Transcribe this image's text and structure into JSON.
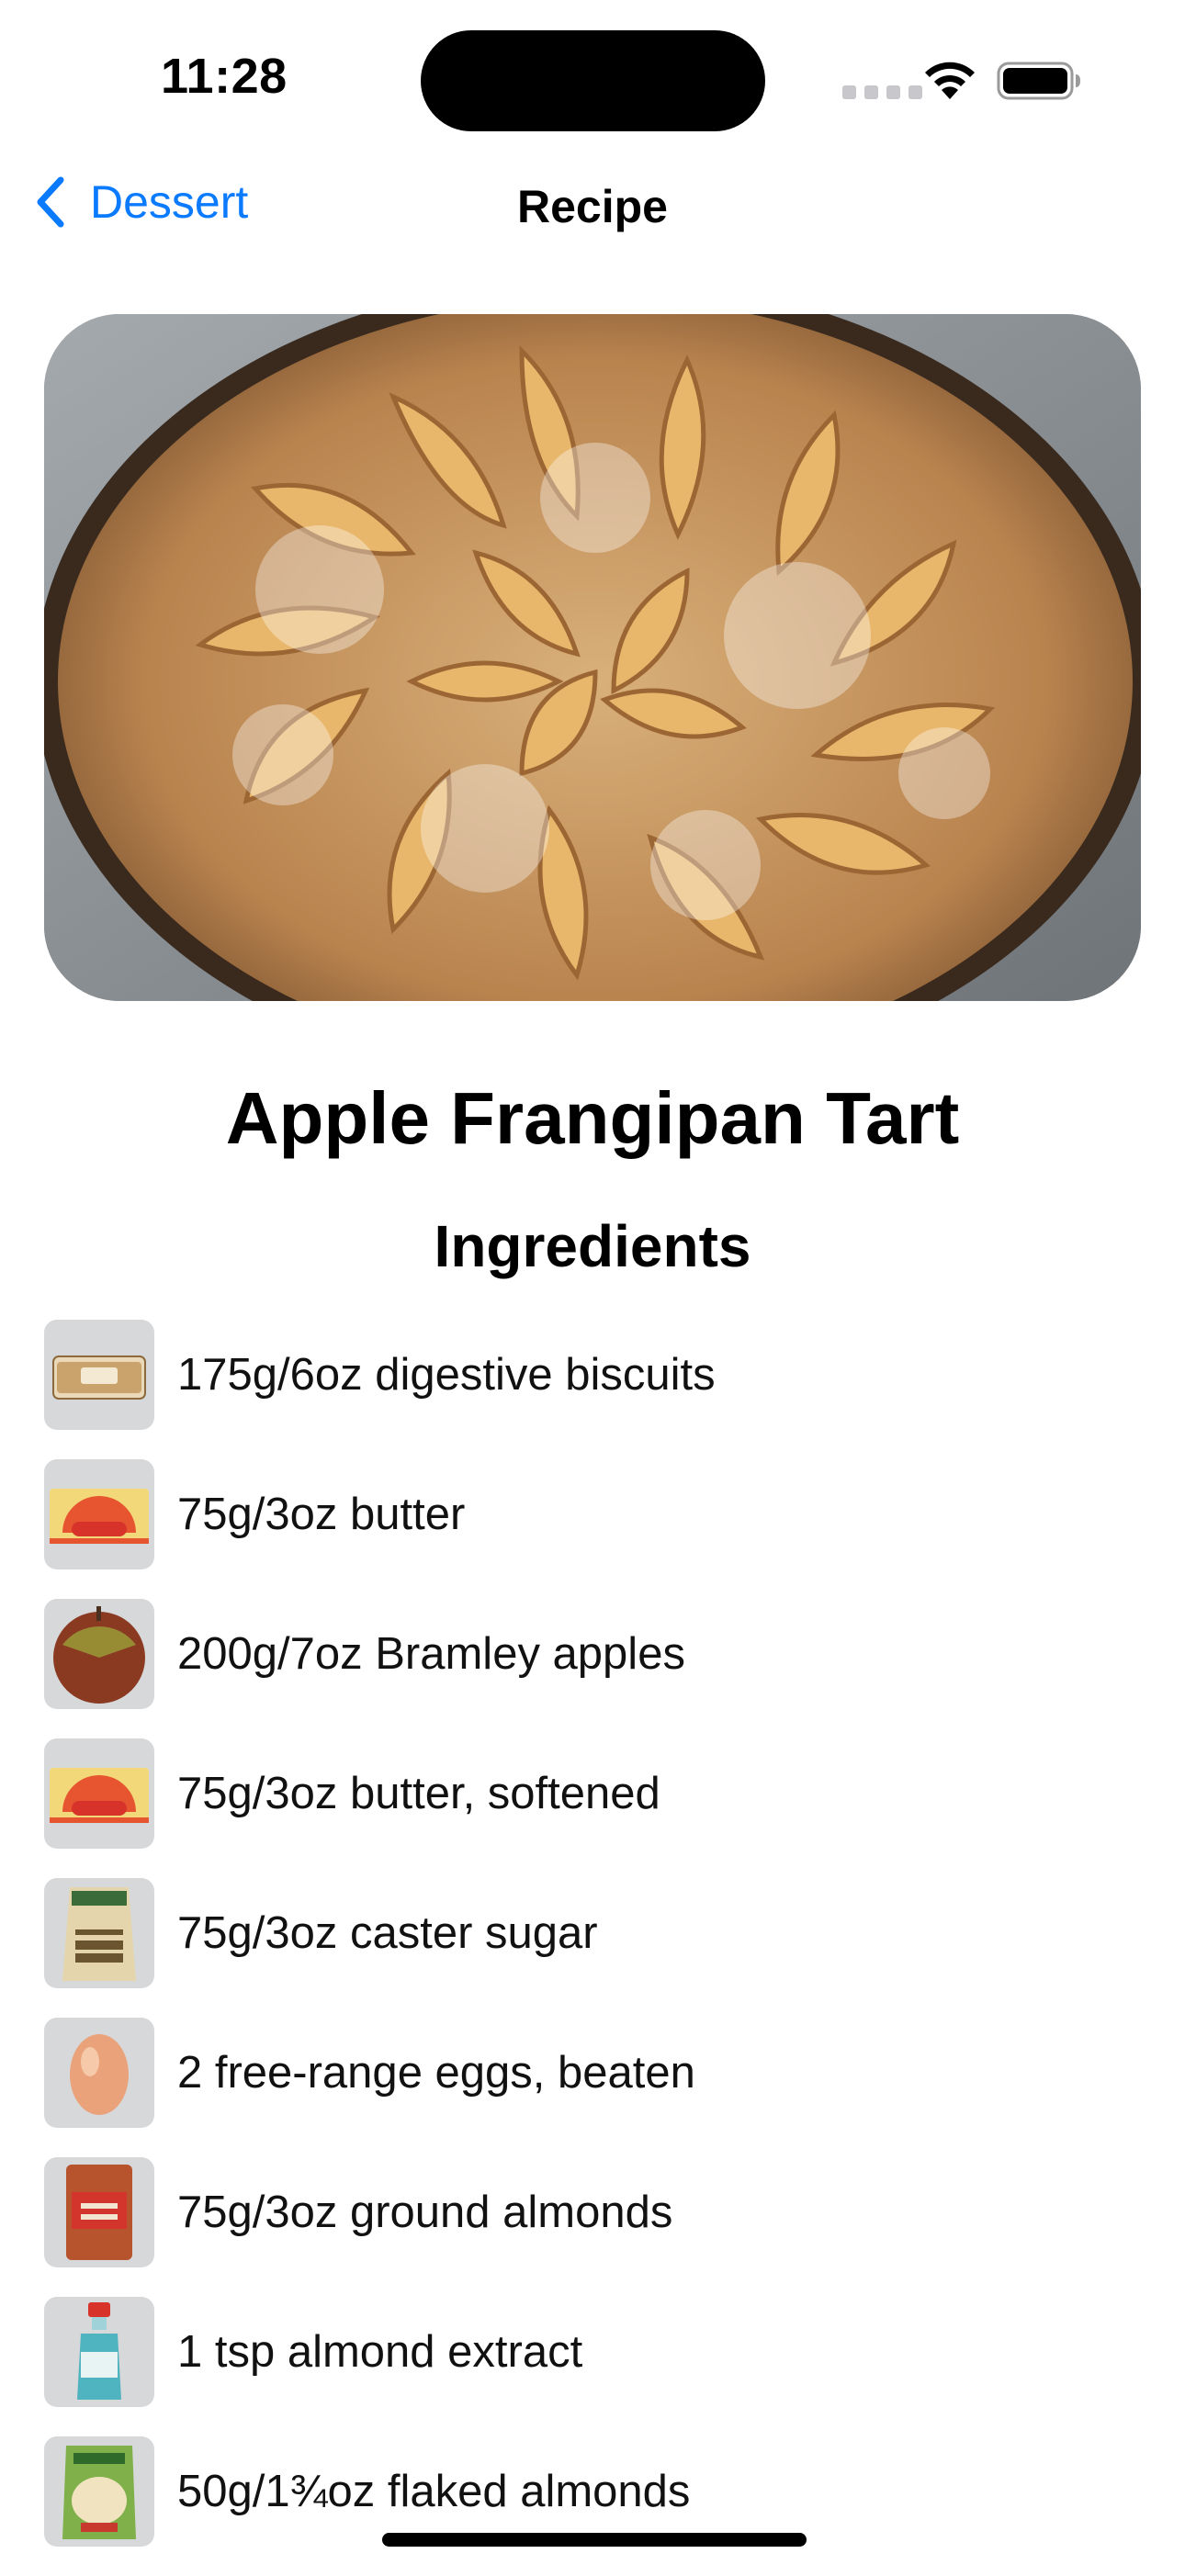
{
  "status_bar": {
    "time": "11:28"
  },
  "nav": {
    "back_label": "Dessert",
    "title": "Recipe"
  },
  "recipe": {
    "name": "Apple Frangipan Tart",
    "ingredients_heading": "Ingredients",
    "ingredients": [
      {
        "text": "175g/6oz digestive biscuits",
        "icon": "biscuits-thumbnail"
      },
      {
        "text": "75g/3oz butter",
        "icon": "butter-thumbnail"
      },
      {
        "text": "200g/7oz Bramley apples",
        "icon": "apple-thumbnail"
      },
      {
        "text": "75g/3oz butter, softened",
        "icon": "butter-thumbnail"
      },
      {
        "text": "75g/3oz caster sugar",
        "icon": "caster-sugar-thumbnail"
      },
      {
        "text": "2 free-range eggs, beaten",
        "icon": "egg-thumbnail"
      },
      {
        "text": "75g/3oz ground almonds",
        "icon": "almonds-bag-thumbnail"
      },
      {
        "text": "1 tsp almond extract",
        "icon": "extract-bottle-thumbnail"
      },
      {
        "text": "50g/1¾oz flaked almonds",
        "icon": "flaked-almonds-thumbnail"
      }
    ]
  },
  "colors": {
    "accent": "#0a7aff",
    "thumb_background": "#d6d8da"
  }
}
